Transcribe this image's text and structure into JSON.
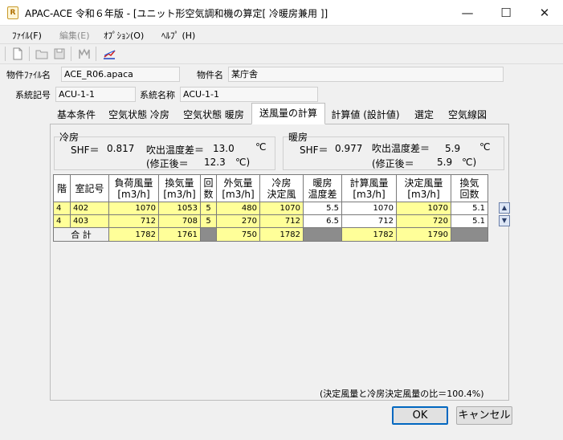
{
  "window": {
    "app_icon": "calc-icon",
    "title": "APAC-ACE 令和６年版 - [ユニット形空気調和機の算定[ 冷暖房兼用 ]]",
    "minimize": "—",
    "maximize": "☐",
    "close": "✕"
  },
  "menu": {
    "file": "ﾌｧｲﾙ(F)",
    "edit": "編集(E)",
    "options": "ｵﾌﾟｼｮﾝ(O)",
    "help": "ﾍﾙﾌﾟ (H)"
  },
  "toolbar": {
    "icons": [
      "new-file-icon",
      "open-folder-icon",
      "save-icon",
      "print-icon",
      "chart-icon"
    ]
  },
  "file_info": {
    "file_label": "物件ﾌｧｲﾙ名",
    "file_value": "ACE_R06.apaca",
    "name_label": "物件名",
    "name_value": "某庁舎"
  },
  "system": {
    "code_label": "系統記号",
    "code_value": "ACU-1-1",
    "name_label": "系統名称",
    "name_value": "ACU-1-1"
  },
  "tabs": [
    "基本条件",
    "空気状態 冷房",
    "空気状態 暖房",
    "送風量の計算",
    "計算値 (設計値)",
    "選定",
    "空気線図"
  ],
  "active_tab": 3,
  "cooling": {
    "title": "冷房",
    "shf_label": "SHF＝",
    "shf_value": "0.817",
    "dt_label": "吹出温度差＝",
    "dt_value": "13.0",
    "unit": "℃",
    "corrected_label": "(修正後＝",
    "corrected_value": "12.3",
    "corrected_unit": "℃)"
  },
  "heating": {
    "title": "暖房",
    "shf_label": "SHF＝",
    "shf_value": "0.977",
    "dt_label": "吹出温度差＝",
    "dt_value": "5.9",
    "unit": "℃",
    "corrected_label": "(修正後＝",
    "corrected_value": "5.9",
    "corrected_unit": "℃)"
  },
  "table": {
    "headers": [
      [
        "階"
      ],
      [
        "室記号"
      ],
      [
        "負荷風量",
        "[m3/h]"
      ],
      [
        "換気量",
        "[m3/h]"
      ],
      [
        "回",
        "数"
      ],
      [
        "外気量",
        "[m3/h]"
      ],
      [
        "冷房",
        "決定風"
      ],
      [
        "暖房",
        "温度差"
      ],
      [
        "計算風量",
        "[m3/h]"
      ],
      [
        "決定風量",
        "[m3/h]"
      ],
      [
        "換気",
        "回数"
      ]
    ],
    "rows": [
      [
        "4",
        "402",
        "1070",
        "1053",
        "5",
        "480",
        "1070",
        "5.5",
        "1070",
        "1070",
        "5.1"
      ],
      [
        "4",
        "403",
        "712",
        "708",
        "5",
        "270",
        "712",
        "6.5",
        "712",
        "720",
        "5.1"
      ]
    ],
    "total_label": "合 計",
    "totals": {
      "load_airflow": "1782",
      "ventilation": "1761",
      "outdoor_air": "750",
      "cooling_airflow": "1782",
      "calc_airflow": "1782",
      "decided_airflow": "1790"
    }
  },
  "ratio_note": "(決定風量と冷房決定風量の比＝100.4%)",
  "buttons": {
    "ok": "OK",
    "cancel": "キャンセル"
  }
}
